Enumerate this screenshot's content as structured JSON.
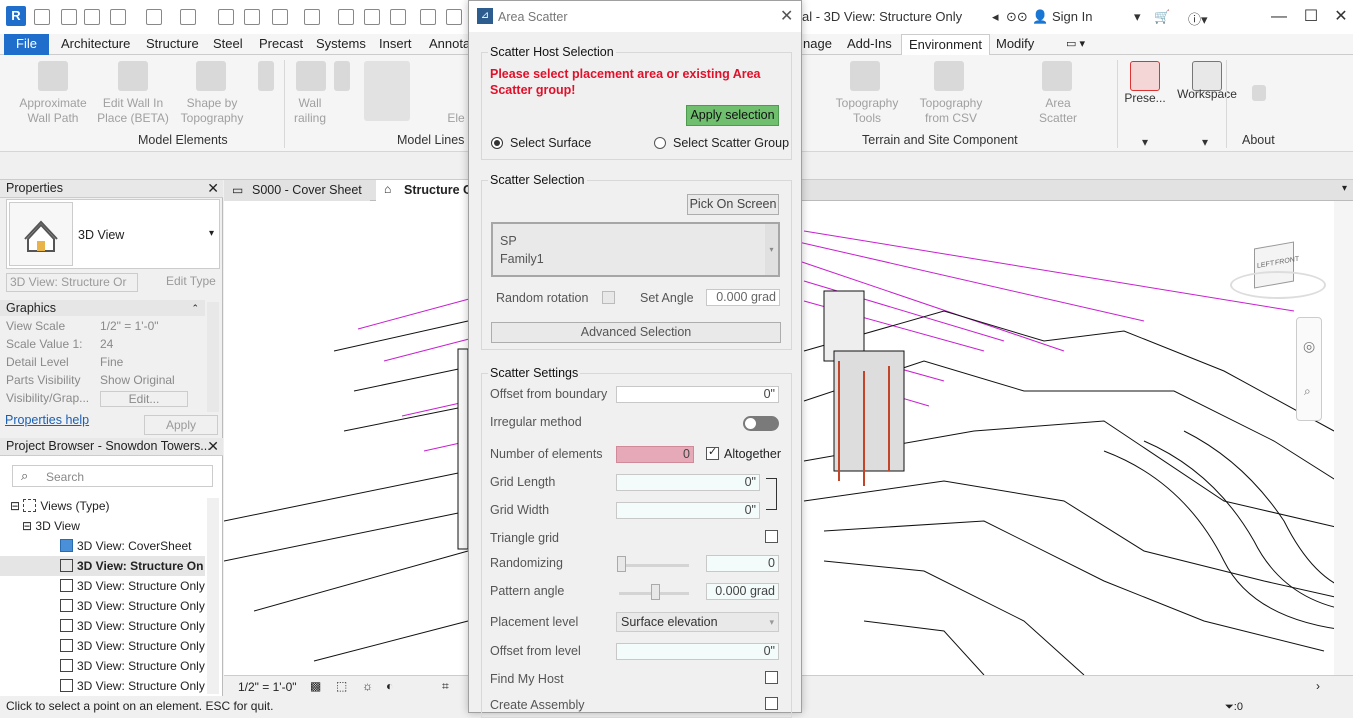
{
  "window": {
    "title": "al - 3D View: Structure Only",
    "sign_in": "Sign In"
  },
  "ribbon_tabs": [
    "File",
    "Architecture",
    "Structure",
    "Steel",
    "Precast",
    "Systems",
    "Insert",
    "Annota",
    "nage",
    "Add-Ins",
    "Environment",
    "Modify"
  ],
  "ribbon": {
    "buttons": [
      {
        "label": "Approximate\nWall Path"
      },
      {
        "label": "Edit Wall In\nPlace (BETA)"
      },
      {
        "label": "Shape by\nTopography"
      },
      {
        "label": "Wall\nrailing"
      },
      {
        "label": "Ele"
      },
      {
        "label": "Topography\nTools"
      },
      {
        "label": "Topography\nfrom CSV"
      },
      {
        "label": "Area\nScatter"
      },
      {
        "label": "Prese..."
      },
      {
        "label": "Workspace"
      }
    ],
    "panels": [
      "Model Elements",
      "Model Lines",
      "Terrain and Site Component",
      "About"
    ]
  },
  "properties": {
    "title": "Properties",
    "type_name": "3D View",
    "selector": "3D View: Structure Or",
    "edit_type": "Edit Type",
    "section": "Graphics",
    "rows": [
      {
        "label": "View Scale",
        "value": "1/2\" = 1'-0\""
      },
      {
        "label": "Scale Value    1:",
        "value": "24"
      },
      {
        "label": "Detail Level",
        "value": "Fine"
      },
      {
        "label": "Parts Visibility",
        "value": "Show Original"
      },
      {
        "label": "Visibility/Grap...",
        "value": "Edit..."
      }
    ],
    "help_link": "Properties help",
    "apply": "Apply"
  },
  "browser": {
    "title": "Project Browser - Snowdon Towers...",
    "search_placeholder": "Search",
    "items": [
      "Views (Type)",
      "3D View",
      "3D View: CoverSheet",
      "3D View: Structure On",
      "3D View: Structure Only",
      "3D View: Structure Only",
      "3D View: Structure Only",
      "3D View: Structure Only",
      "3D View: Structure Only",
      "3D View: Structure Only"
    ]
  },
  "view_tabs": [
    "S000 - Cover Sheet",
    "Structure O"
  ],
  "view_bar": {
    "scale": "1/2\" = 1'-0\""
  },
  "status_bar": {
    "text": "Click to select a point on an element. ESC for quit."
  },
  "viewcube": {
    "left": "LEFT",
    "front": "FRONT"
  },
  "dialog": {
    "title": "Area Scatter",
    "host_group": "Scatter Host Selection",
    "warning": "Please select placement area or existing Area Scatter group!",
    "apply_selection": "Apply selection",
    "radio_surface": "Select Surface",
    "radio_group": "Select Scatter Group",
    "selection_group": "Scatter Selection",
    "pick_on_screen": "Pick On Screen",
    "list_items": [
      "SP",
      "Family1"
    ],
    "random_rotation": "Random rotation",
    "set_angle": "Set Angle",
    "set_angle_value": "0.000 grad",
    "advanced_selection": "Advanced Selection",
    "settings_group": "Scatter Settings",
    "offset_boundary": "Offset from boundary",
    "offset_boundary_value": "0\"",
    "irregular_method": "Irregular method",
    "num_elements": "Number of elements",
    "num_elements_value": "0",
    "altogether": "Altogether",
    "grid_length": "Grid Length",
    "grid_length_value": "0\"",
    "grid_width": "Grid Width",
    "grid_width_value": "0\"",
    "triangle_grid": "Triangle grid",
    "randomizing": "Randomizing",
    "randomizing_value": "0",
    "pattern_angle": "Pattern angle",
    "pattern_angle_value": "0.000 grad",
    "placement_level": "Placement level",
    "placement_level_value": "Surface elevation",
    "offset_level": "Offset from level",
    "offset_level_value": "0\"",
    "find_host": "Find My Host",
    "create_assembly": "Create Assembly"
  },
  "colors": {
    "accent_blue": "#1f6ecb",
    "warning_red": "#e0102a",
    "apply_green": "#6fbf6f",
    "pink_field": "#e6a9b8",
    "magenta_lines": "#c81fd1"
  }
}
